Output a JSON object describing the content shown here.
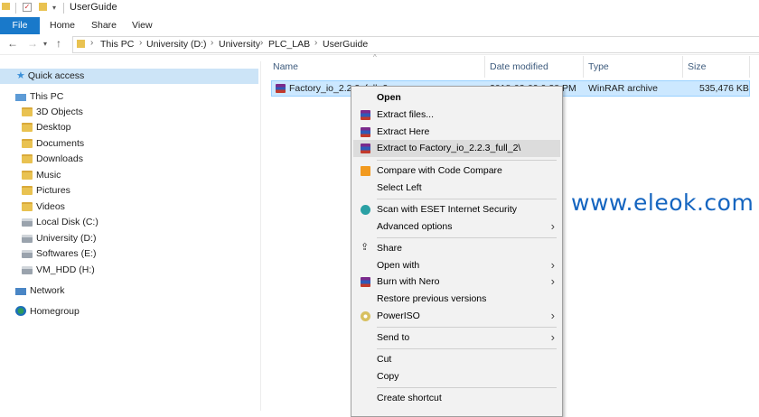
{
  "window": {
    "title": "UserGuide"
  },
  "ribbon": {
    "tabs": [
      "File",
      "Home",
      "Share",
      "View"
    ]
  },
  "address": {
    "crumbs": [
      "This PC",
      "University (D:)",
      "University",
      "PLC_LAB",
      "UserGuide"
    ]
  },
  "navpane": {
    "quick_access": "Quick access",
    "this_pc": "This PC",
    "items": [
      "3D Objects",
      "Desktop",
      "Documents",
      "Downloads",
      "Music",
      "Pictures",
      "Videos",
      "Local Disk (C:)",
      "University (D:)",
      "Softwares (E:)",
      "VM_HDD (H:)"
    ],
    "network": "Network",
    "homegroup": "Homegroup"
  },
  "columns": {
    "name": "Name",
    "date": "Date modified",
    "type": "Type",
    "size": "Size"
  },
  "file": {
    "name": "Factory_io_2.2.3_full_2",
    "date": "2018-03-09 9:38 PM",
    "type": "WinRAR archive",
    "size": "535,476 KB"
  },
  "menu": {
    "open": "Open",
    "extract_files": "Extract files...",
    "extract_here": "Extract Here",
    "extract_to": "Extract to Factory_io_2.2.3_full_2\\",
    "compare": "Compare with Code Compare",
    "select_left": "Select Left",
    "scan": "Scan with ESET Internet Security",
    "advanced": "Advanced options",
    "share": "Share",
    "open_with": "Open with",
    "burn": "Burn with Nero",
    "restore": "Restore previous versions",
    "poweriso": "PowerISO",
    "send_to": "Send to",
    "cut": "Cut",
    "copy": "Copy",
    "create_shortcut": "Create shortcut"
  },
  "watermark": "www.eleok.com",
  "colors": {
    "accent": "#1979ca",
    "selection": "#cce8ff",
    "menu_bg": "#f2f2f2",
    "watermark": "#1565c0"
  }
}
